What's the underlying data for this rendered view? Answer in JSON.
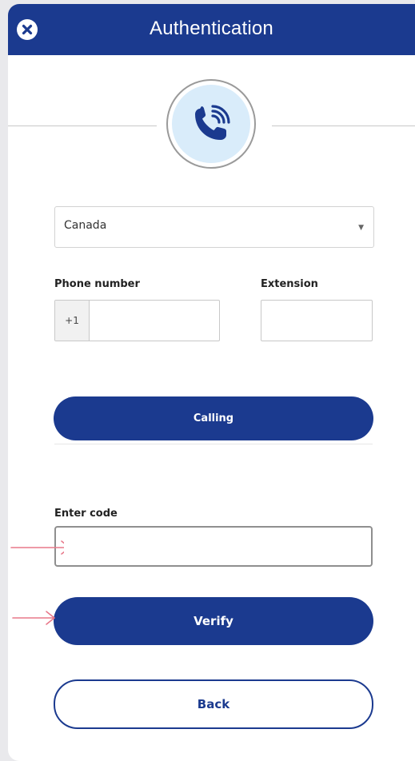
{
  "header": {
    "title": "Authentication",
    "close_icon": "close-circle-icon"
  },
  "hero": {
    "icon": "phone-calling-icon"
  },
  "country": {
    "selected": "Canada"
  },
  "phone": {
    "label": "Phone number",
    "prefix": "+1",
    "value": ""
  },
  "extension": {
    "label": "Extension",
    "value": ""
  },
  "actions": {
    "calling_label": "Calling",
    "verify_label": "Verify",
    "back_label": "Back"
  },
  "code": {
    "label": "Enter code",
    "value": ""
  },
  "annotations": {
    "arrow_icon": "right-arrow-icon"
  },
  "colors": {
    "brand": "#1b3a8f",
    "icon_background": "#d9ecfa",
    "annotation_arrow": "#e8788a"
  }
}
